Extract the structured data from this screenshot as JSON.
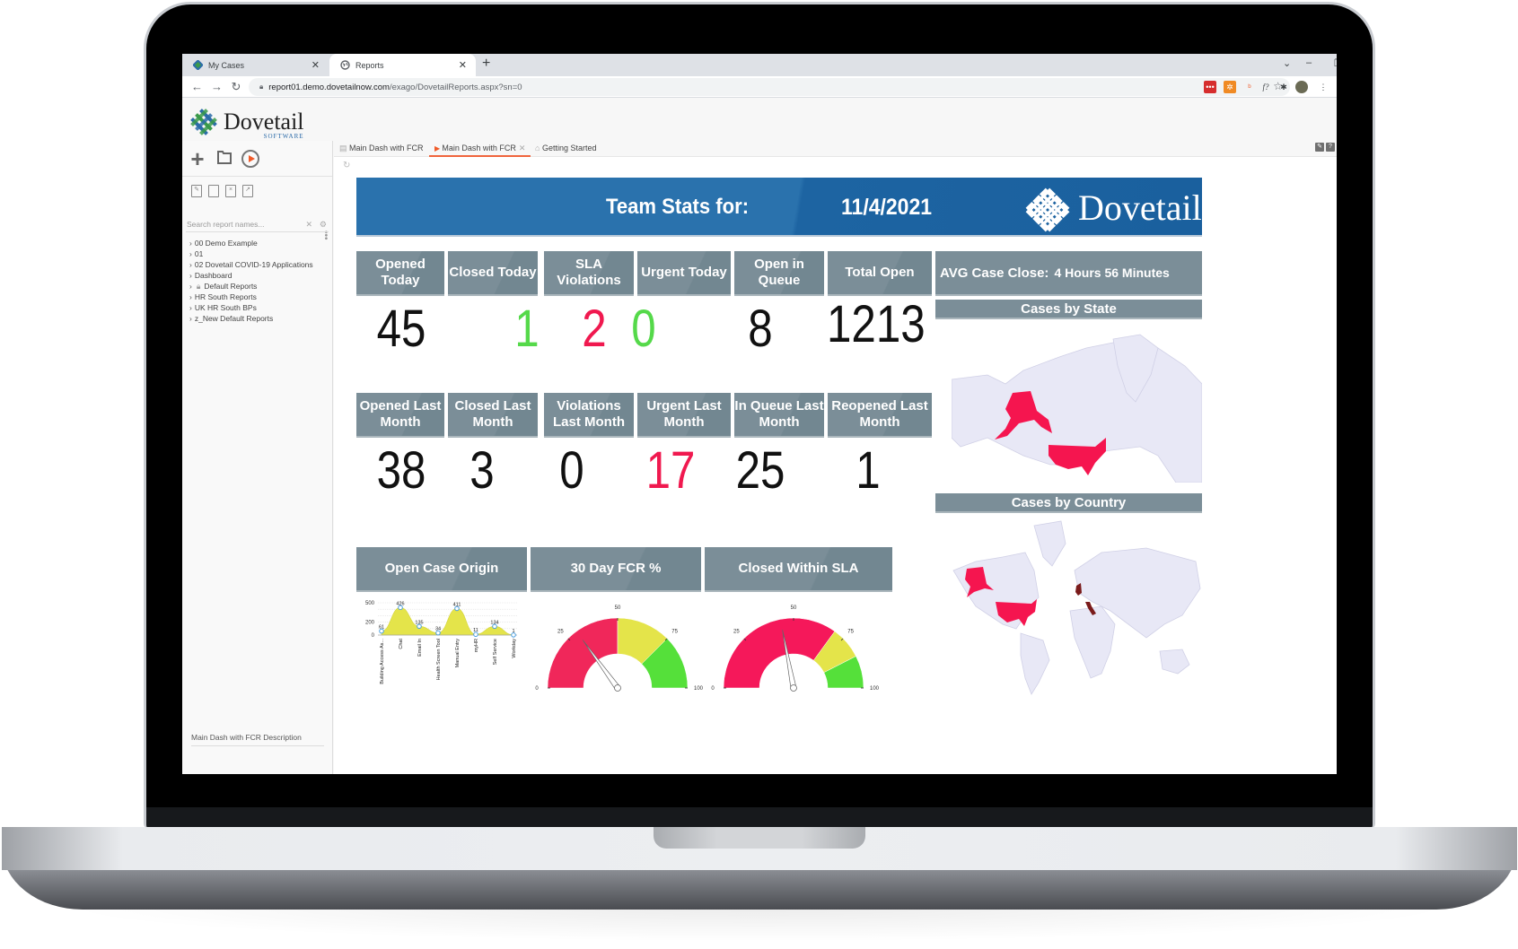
{
  "browser": {
    "tabs": [
      {
        "label": "My Cases",
        "active": false
      },
      {
        "label": "Reports",
        "active": true
      }
    ],
    "new_tab": "+",
    "url_host": "report01.demo.dovetailnow.com",
    "url_path": "/exago/DovetailReports.aspx?sn=0",
    "window_controls": {
      "minimize": "–",
      "restore": "❐",
      "close": "✕",
      "dropdown": "⌄"
    },
    "extensions": [
      "lastpass-icon",
      "hubspot-icon",
      "hubspot-sprocket-icon",
      "formula-icon",
      "extensions-icon",
      "profile-avatar",
      "menu-icon"
    ]
  },
  "app": {
    "logo": {
      "name": "Dovetail",
      "sub": "SOFTWARE"
    },
    "sidebar": {
      "search_placeholder": "Search report names...",
      "tree": [
        {
          "label": "00 Demo Example"
        },
        {
          "label": "01"
        },
        {
          "label": "02 Dovetail COVID-19 Applications"
        },
        {
          "label": "Dashboard"
        },
        {
          "label": "Default Reports",
          "locked": true
        },
        {
          "label": "HR South Reports"
        },
        {
          "label": "UK HR South BPs"
        },
        {
          "label": "z_New Default Reports"
        }
      ],
      "description": "Main Dash with FCR Description"
    },
    "report_tabs": [
      {
        "label": "Main Dash with FCR",
        "active": false
      },
      {
        "label": "Main Dash with FCR",
        "active": true
      },
      {
        "label": "Getting Started",
        "active": false
      }
    ]
  },
  "dashboard": {
    "banner": {
      "title": "Team Stats for:",
      "date": "11/4/2021",
      "logo": "Dovetail",
      "logo_sub": "SOFTWARE"
    },
    "colors": {
      "header": "#7b8e98",
      "green": "#55d94a",
      "red": "#f0194f",
      "yellow": "#e4e44a",
      "banner": "#2a72ad"
    },
    "today": [
      {
        "label": "Opened Today",
        "value": "45",
        "color": "default"
      },
      {
        "label": "Closed Today",
        "value": "1",
        "color": "green"
      },
      {
        "label": "SLA Violations",
        "value": "2",
        "color": "red"
      },
      {
        "label": "Urgent Today",
        "value": "0",
        "color": "green"
      },
      {
        "label": "Open in Queue",
        "value": "8",
        "color": "default"
      },
      {
        "label": "Total Open",
        "value": "1213",
        "color": "default"
      }
    ],
    "last_month": [
      {
        "label": "Opened Last Month",
        "value": "38",
        "color": "default"
      },
      {
        "label": "Closed Last Month",
        "value": "3",
        "color": "default"
      },
      {
        "label": "Violations Last Month",
        "value": "0",
        "color": "default"
      },
      {
        "label": "Urgent Last Month",
        "value": "17",
        "color": "red"
      },
      {
        "label": "In Queue Last Month",
        "value": "25",
        "color": "default"
      },
      {
        "label": "Reopened Last Month",
        "value": "1",
        "color": "default"
      }
    ],
    "avg_case_close": {
      "label": "AVG Case Close:",
      "value": "4 Hours 56 Minutes"
    },
    "maps": {
      "state_title": "Cases by State",
      "state_highlighted": [
        "Alaska",
        "Contiguous US"
      ],
      "country_title": "Cases by Country",
      "country_highlighted": [
        {
          "name": "United States",
          "level": "high"
        },
        {
          "name": "United Kingdom",
          "level": "low"
        },
        {
          "name": "Italy",
          "level": "low"
        }
      ]
    },
    "section_headers": {
      "origin": "Open Case Origin",
      "fcr": "30 Day FCR %",
      "sla": "Closed Within SLA"
    }
  },
  "chart_data": [
    {
      "type": "area",
      "title": "Open Case Origin",
      "categories": [
        "Building Access As...",
        "Chat",
        "Email In",
        "Health Screen Tool",
        "Manual Entry",
        "myHR",
        "Self Service",
        "Workday"
      ],
      "values": [
        61,
        426,
        135,
        34,
        411,
        11,
        134,
        1
      ],
      "yticks": [
        "0",
        "200",
        "500"
      ],
      "ylim": [
        0,
        500
      ],
      "grid": true
    },
    {
      "type": "gauge",
      "title": "30 Day FCR %",
      "value": 30,
      "range": [
        0,
        100
      ],
      "ticks": [
        "0",
        "25",
        "50",
        "75",
        "100"
      ],
      "bands": [
        {
          "from": 0,
          "to": 50,
          "color": "#f0275a"
        },
        {
          "from": 50,
          "to": 75,
          "color": "#e4e44a"
        },
        {
          "from": 75,
          "to": 100,
          "color": "#55e03a"
        }
      ]
    },
    {
      "type": "gauge",
      "title": "Closed Within SLA",
      "value": 44,
      "range": [
        0,
        100
      ],
      "ticks": [
        "0",
        "25",
        "50",
        "75",
        "100"
      ],
      "bands": [
        {
          "from": 0,
          "to": 70,
          "color": "#f5185a"
        },
        {
          "from": 70,
          "to": 85,
          "color": "#e4e44a"
        },
        {
          "from": 85,
          "to": 100,
          "color": "#55e03a"
        }
      ]
    }
  ]
}
